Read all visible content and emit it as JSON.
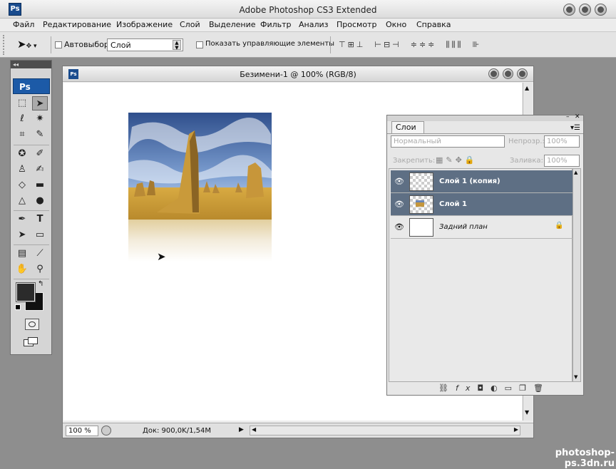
{
  "app": {
    "title": "Adobe Photoshop CS3 Extended",
    "logo": "Ps"
  },
  "menu": [
    "Файл",
    "Редактирование",
    "Изображение",
    "Слой",
    "Выделение",
    "Фильтр",
    "Анализ",
    "Просмотр",
    "Окно",
    "Справка"
  ],
  "options": {
    "auto_select_label": "Автовыбор:",
    "auto_select_value": "Слой",
    "show_controls_label": "Показать управляющие элементы"
  },
  "toolbox": {
    "collapse": "◂◂",
    "logo": "Ps"
  },
  "document": {
    "title": "Безимени-1 @ 100% (RGB/8)",
    "zoom": "100 %",
    "doc_info": "Док: 900,0K/1,54M"
  },
  "layers_panel": {
    "tab": "Слои",
    "blend_mode": "Нормальный",
    "opacity_label": "Непрозр.:",
    "opacity_value": "100%",
    "lock_label": "Закрепить:",
    "fill_label": "Заливка:",
    "fill_value": "100%",
    "layers": [
      {
        "name": "Слой 1 (копия)",
        "selected": true
      },
      {
        "name": "Слой 1",
        "selected": true
      },
      {
        "name": "Задний план",
        "selected": false
      }
    ]
  },
  "watermark": "photoshop-ps.3dn.ru",
  "colors": {
    "selection": "#5e6f84",
    "foreground": "#2b2b2b",
    "background": "#111111"
  }
}
